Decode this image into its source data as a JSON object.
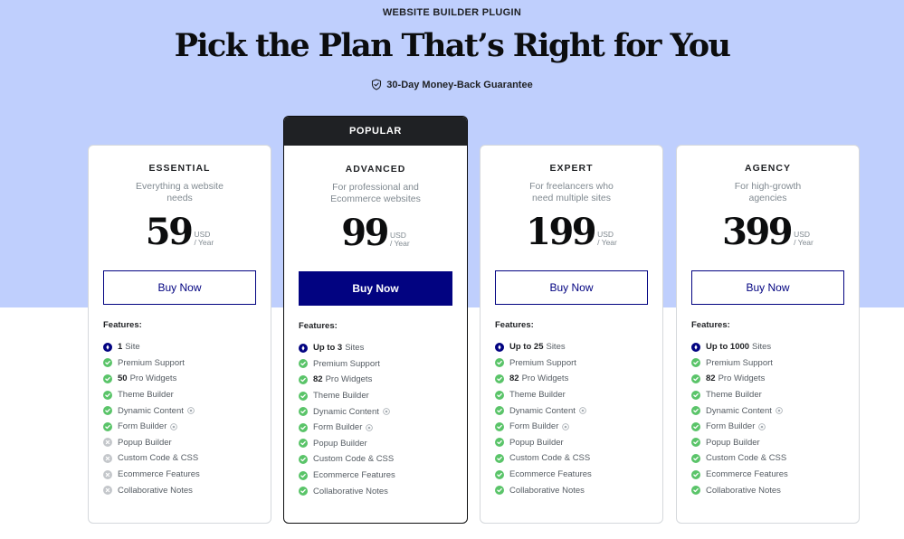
{
  "header": {
    "eyebrow": "WEBSITE BUILDER PLUGIN",
    "title": "Pick the Plan That’s Right for You",
    "guarantee": "30-Day Money-Back Guarantee",
    "guarantee_icon": "shield-check-icon"
  },
  "colors": {
    "hero_background": "#bfcffd",
    "primary": "#020381",
    "check": "#5ac469",
    "cross": "#c4c7cb",
    "popular_badge": "#1f2124"
  },
  "features_label": "Features:",
  "plans": [
    {
      "id": "essential",
      "name": "ESSENTIAL",
      "description": "Everything a website needs",
      "price": "59",
      "currency": "USD",
      "period": "/ Year",
      "button": "Buy Now",
      "popular": false,
      "features": [
        {
          "icon": "sites",
          "bold": "1",
          "text": "Site",
          "info": false
        },
        {
          "icon": "check",
          "bold": "",
          "text": "Premium Support",
          "info": false
        },
        {
          "icon": "check",
          "bold": "50",
          "text": "Pro Widgets",
          "info": false
        },
        {
          "icon": "check",
          "bold": "",
          "text": "Theme Builder",
          "info": false
        },
        {
          "icon": "check",
          "bold": "",
          "text": "Dynamic Content",
          "info": true
        },
        {
          "icon": "check",
          "bold": "",
          "text": "Form Builder",
          "info": true
        },
        {
          "icon": "cross",
          "bold": "",
          "text": "Popup Builder",
          "info": false
        },
        {
          "icon": "cross",
          "bold": "",
          "text": "Custom Code & CSS",
          "info": false
        },
        {
          "icon": "cross",
          "bold": "",
          "text": "Ecommerce Features",
          "info": false
        },
        {
          "icon": "cross",
          "bold": "",
          "text": "Collaborative Notes",
          "info": false
        }
      ]
    },
    {
      "id": "advanced",
      "name": "ADVANCED",
      "description": "For professional and Ecommerce websites",
      "price": "99",
      "currency": "USD",
      "period": "/ Year",
      "button": "Buy Now",
      "popular": true,
      "badge": "POPULAR",
      "features": [
        {
          "icon": "sites",
          "bold": "Up to 3",
          "text": "Sites",
          "info": false
        },
        {
          "icon": "check",
          "bold": "",
          "text": "Premium Support",
          "info": false
        },
        {
          "icon": "check",
          "bold": "82",
          "text": "Pro Widgets",
          "info": false
        },
        {
          "icon": "check",
          "bold": "",
          "text": "Theme Builder",
          "info": false
        },
        {
          "icon": "check",
          "bold": "",
          "text": "Dynamic Content",
          "info": true
        },
        {
          "icon": "check",
          "bold": "",
          "text": "Form Builder",
          "info": true
        },
        {
          "icon": "check",
          "bold": "",
          "text": "Popup Builder",
          "info": false
        },
        {
          "icon": "check",
          "bold": "",
          "text": "Custom Code & CSS",
          "info": false
        },
        {
          "icon": "check",
          "bold": "",
          "text": "Ecommerce Features",
          "info": false
        },
        {
          "icon": "check",
          "bold": "",
          "text": "Collaborative Notes",
          "info": false
        }
      ]
    },
    {
      "id": "expert",
      "name": "EXPERT",
      "description": "For freelancers who need multiple sites",
      "price": "199",
      "currency": "USD",
      "period": "/ Year",
      "button": "Buy Now",
      "popular": false,
      "features": [
        {
          "icon": "sites",
          "bold": "Up to 25",
          "text": "Sites",
          "info": false
        },
        {
          "icon": "check",
          "bold": "",
          "text": "Premium Support",
          "info": false
        },
        {
          "icon": "check",
          "bold": "82",
          "text": "Pro Widgets",
          "info": false
        },
        {
          "icon": "check",
          "bold": "",
          "text": "Theme Builder",
          "info": false
        },
        {
          "icon": "check",
          "bold": "",
          "text": "Dynamic Content",
          "info": true
        },
        {
          "icon": "check",
          "bold": "",
          "text": "Form Builder",
          "info": true
        },
        {
          "icon": "check",
          "bold": "",
          "text": "Popup Builder",
          "info": false
        },
        {
          "icon": "check",
          "bold": "",
          "text": "Custom Code & CSS",
          "info": false
        },
        {
          "icon": "check",
          "bold": "",
          "text": "Ecommerce Features",
          "info": false
        },
        {
          "icon": "check",
          "bold": "",
          "text": "Collaborative Notes",
          "info": false
        }
      ]
    },
    {
      "id": "agency",
      "name": "AGENCY",
      "description": "For high-growth agencies",
      "price": "399",
      "currency": "USD",
      "period": "/ Year",
      "button": "Buy Now",
      "popular": false,
      "features": [
        {
          "icon": "sites",
          "bold": "Up to 1000",
          "text": "Sites",
          "info": false
        },
        {
          "icon": "check",
          "bold": "",
          "text": "Premium Support",
          "info": false
        },
        {
          "icon": "check",
          "bold": "82",
          "text": "Pro Widgets",
          "info": false
        },
        {
          "icon": "check",
          "bold": "",
          "text": "Theme Builder",
          "info": false
        },
        {
          "icon": "check",
          "bold": "",
          "text": "Dynamic Content",
          "info": true
        },
        {
          "icon": "check",
          "bold": "",
          "text": "Form Builder",
          "info": true
        },
        {
          "icon": "check",
          "bold": "",
          "text": "Popup Builder",
          "info": false
        },
        {
          "icon": "check",
          "bold": "",
          "text": "Custom Code & CSS",
          "info": false
        },
        {
          "icon": "check",
          "bold": "",
          "text": "Ecommerce Features",
          "info": false
        },
        {
          "icon": "check",
          "bold": "",
          "text": "Collaborative Notes",
          "info": false
        }
      ]
    }
  ]
}
